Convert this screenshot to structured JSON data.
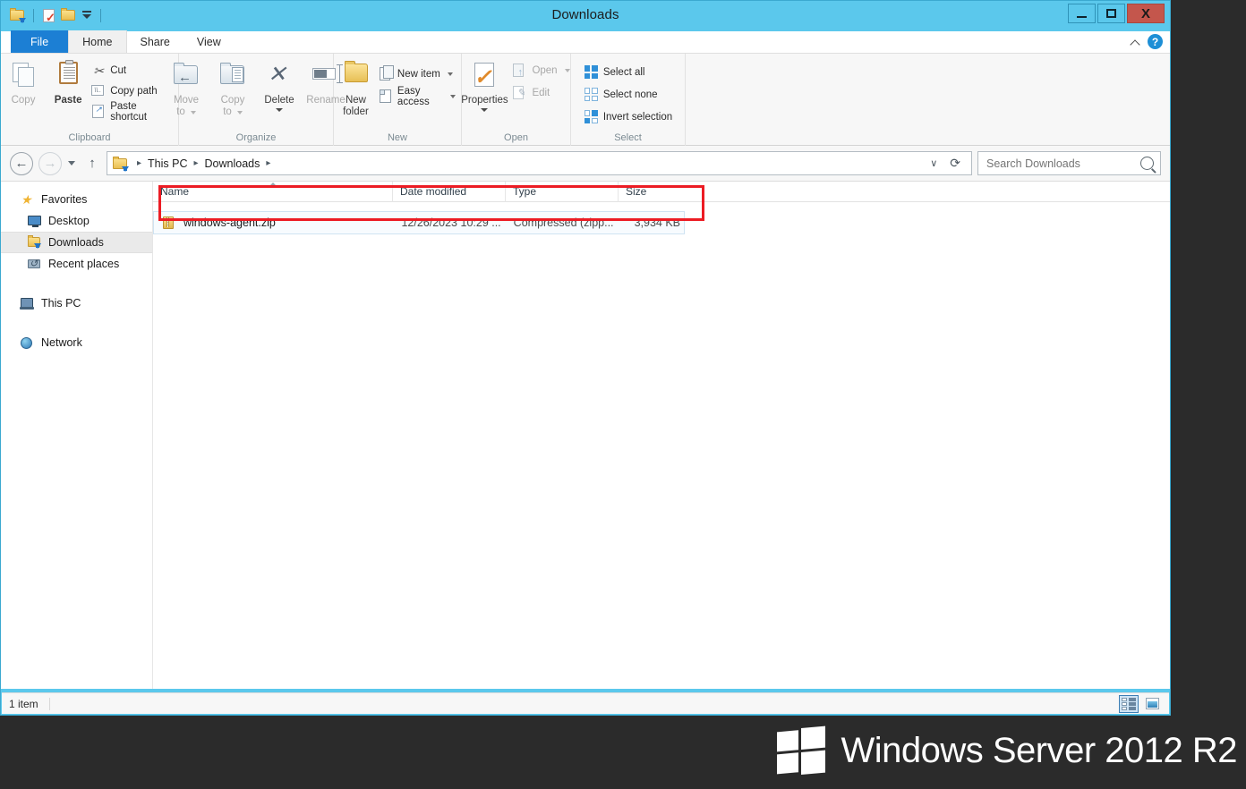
{
  "window": {
    "title": "Downloads",
    "controls": {
      "minimize": "—",
      "maximize": "□",
      "close": "X"
    }
  },
  "quick_access": {
    "items": [
      {
        "name": "downloads-folder-icon",
        "label": "Downloads"
      },
      {
        "name": "properties-icon",
        "label": "Properties"
      },
      {
        "name": "new-folder-icon",
        "label": "New folder"
      },
      {
        "name": "customize-quick-access-caret",
        "label": "Customize Quick Access Toolbar"
      }
    ]
  },
  "tabs": [
    {
      "id": "file",
      "label": "File"
    },
    {
      "id": "home",
      "label": "Home"
    },
    {
      "id": "share",
      "label": "Share"
    },
    {
      "id": "view",
      "label": "View"
    }
  ],
  "tabstrip_right": {
    "collapse_label": "Minimize the Ribbon",
    "help_label": "?"
  },
  "ribbon": {
    "groups": [
      {
        "name": "Clipboard",
        "big": [
          {
            "label": "Copy",
            "icon": "copy-icon",
            "disabled": true
          },
          {
            "label": "Paste",
            "icon": "paste-icon",
            "disabled": false
          }
        ],
        "small": [
          {
            "label": "Cut",
            "icon": "cut-icon",
            "disabled": false
          },
          {
            "label": "Copy path",
            "icon": "copy-path-icon",
            "disabled": false
          },
          {
            "label": "Paste shortcut",
            "icon": "paste-shortcut-icon",
            "disabled": false
          }
        ]
      },
      {
        "name": "Organize",
        "big": [
          {
            "label": "Move\nto",
            "label_line1": "Move",
            "label_line2": "to",
            "icon": "move-to-icon",
            "disabled": true,
            "caret": true
          },
          {
            "label": "Copy\nto",
            "label_line1": "Copy",
            "label_line2": "to",
            "icon": "copy-to-icon",
            "disabled": true,
            "caret": true
          },
          {
            "label": "Delete",
            "icon": "delete-icon",
            "disabled": false,
            "caret": true
          },
          {
            "label": "Rename",
            "icon": "rename-icon",
            "disabled": true,
            "caret": false
          }
        ]
      },
      {
        "name": "New",
        "big": [
          {
            "label_line1": "New",
            "label_line2": "folder",
            "icon": "new-folder-icon",
            "disabled": false
          }
        ],
        "small": [
          {
            "label": "New item",
            "icon": "new-item-icon",
            "caret": true
          },
          {
            "label": "Easy access",
            "icon": "easy-access-icon",
            "caret": true
          }
        ]
      },
      {
        "name": "Open",
        "big": [
          {
            "label": "Properties",
            "icon": "properties-icon",
            "disabled": false,
            "caret": true
          }
        ],
        "small": [
          {
            "label": "Open",
            "icon": "open-icon",
            "disabled": true,
            "caret": true
          },
          {
            "label": "Edit",
            "icon": "edit-icon",
            "disabled": true
          }
        ]
      },
      {
        "name": "Select",
        "small": [
          {
            "label": "Select all",
            "icon": "select-all-icon"
          },
          {
            "label": "Select none",
            "icon": "select-none-icon"
          },
          {
            "label": "Invert selection",
            "icon": "invert-selection-icon"
          }
        ]
      }
    ]
  },
  "addressbar": {
    "back": "←",
    "forward": "→",
    "recent_caret": "▾",
    "up": "↑",
    "breadcrumb": [
      "This PC",
      "Downloads"
    ],
    "separator": "▸",
    "history_dropdown": "∨",
    "refresh": "⟳",
    "search": {
      "placeholder": "Search Downloads",
      "value": ""
    }
  },
  "navpane": {
    "sections": [
      {
        "label": "Favorites",
        "icon": "star-icon",
        "level": 0,
        "selected": false
      },
      {
        "label": "Desktop",
        "icon": "desktop-icon",
        "level": 1,
        "selected": false
      },
      {
        "label": "Downloads",
        "icon": "downloads-icon",
        "level": 1,
        "selected": true
      },
      {
        "label": "Recent places",
        "icon": "recent-places-icon",
        "level": 1,
        "selected": false
      },
      {
        "label": "This PC",
        "icon": "this-pc-icon",
        "level": 0,
        "selected": false,
        "gap_before": true
      },
      {
        "label": "Network",
        "icon": "network-icon",
        "level": 0,
        "selected": false,
        "gap_before": true
      }
    ]
  },
  "filelist": {
    "columns": [
      {
        "label": "Name",
        "sorted": true
      },
      {
        "label": "Date modified",
        "sorted": false
      },
      {
        "label": "Type",
        "sorted": false
      },
      {
        "label": "Size",
        "sorted": false
      }
    ],
    "rows": [
      {
        "name": "windows-agent.zip",
        "date_modified": "12/26/2023 10:29 ...",
        "type": "Compressed (zipp...",
        "size": "3,934 KB",
        "icon": "zip-file-icon",
        "selected": true
      }
    ]
  },
  "annotation": {
    "color": "#ec1c24",
    "target": "windows-agent.zip file row"
  },
  "statusbar": {
    "item_count": "1 item",
    "views": [
      {
        "name": "details-view-button",
        "label": "Details",
        "active": true
      },
      {
        "name": "large-icons-view-button",
        "label": "Large icons",
        "active": false
      }
    ]
  },
  "branding": {
    "text": "Windows Server 2012 R2",
    "logo": "windows-logo-icon"
  },
  "colors": {
    "titlebar": "#5bc8ec",
    "file_tab": "#1c7fd4",
    "close_button": "#c4564c",
    "annotation_red": "#ec1c24",
    "desktop": "#2b2b2b",
    "selection": "#f7fbfe"
  }
}
